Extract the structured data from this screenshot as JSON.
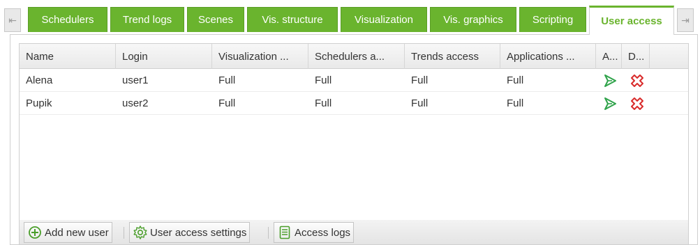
{
  "tabs": [
    {
      "label": "Schedulers",
      "active": false
    },
    {
      "label": "Trend logs",
      "active": false
    },
    {
      "label": "Scenes",
      "active": false
    },
    {
      "label": "Vis. structure",
      "active": false
    },
    {
      "label": "Visualization",
      "active": false
    },
    {
      "label": "Vis. graphics",
      "active": false
    },
    {
      "label": "Scripting",
      "active": false
    },
    {
      "label": "User access",
      "active": true
    }
  ],
  "tab_scroll": {
    "left_icon": "arrow-left-icon",
    "right_icon": "arrow-right-icon"
  },
  "grid": {
    "columns": [
      "Name",
      "Login",
      "Visualization ...",
      "Schedulers a...",
      "Trends access",
      "Applications ...",
      "A...",
      "D..."
    ],
    "rows": [
      {
        "name": "Alena",
        "login": "user1",
        "visualization": "Full",
        "schedulers": "Full",
        "trends": "Full",
        "applications": "Full"
      },
      {
        "name": "Pupik",
        "login": "user2",
        "visualization": "Full",
        "schedulers": "Full",
        "trends": "Full",
        "applications": "Full"
      }
    ],
    "row_actions": {
      "edit_icon": "play-arrow-icon",
      "delete_icon": "delete-cross-icon"
    }
  },
  "toolbar": {
    "add_user_label": "Add new user",
    "settings_label": "User access settings",
    "logs_label": "Access logs"
  },
  "colors": {
    "accent": "#6ab42e",
    "delete": "#d92c2c"
  }
}
